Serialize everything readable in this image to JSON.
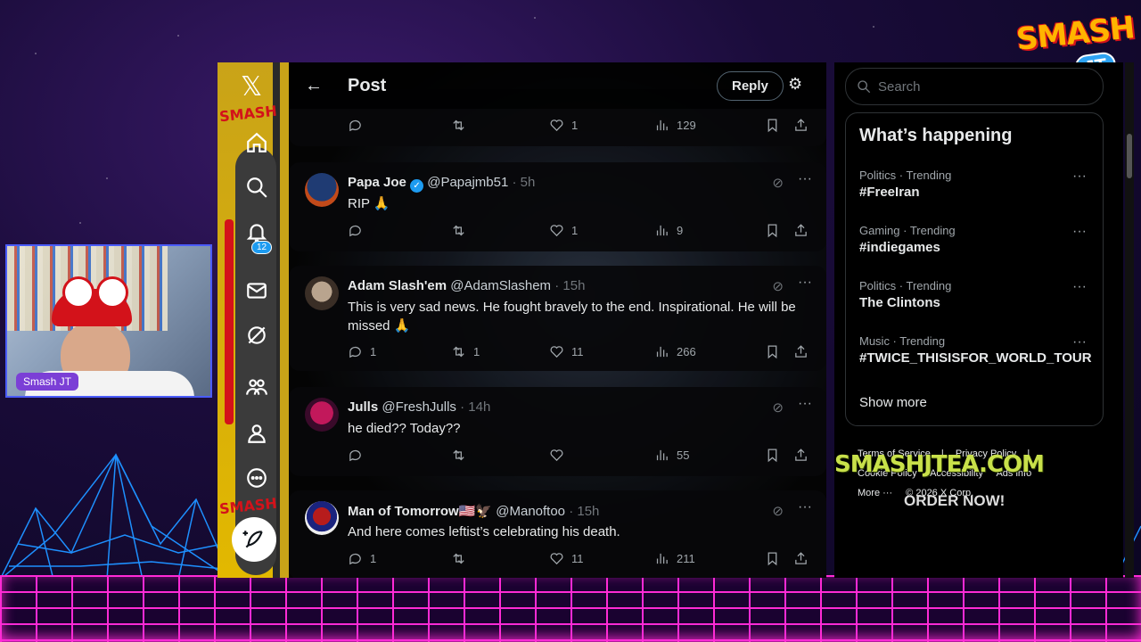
{
  "app": {
    "title": "Post"
  },
  "header": {
    "back_icon": "arrow-left-icon",
    "title": "Post",
    "reply_label": "Reply",
    "filter_icon": "sliders-icon"
  },
  "sidebar": {
    "items": [
      {
        "name": "home",
        "icon": "home-icon"
      },
      {
        "name": "explore",
        "icon": "search-icon"
      },
      {
        "name": "notifications",
        "icon": "bell-icon"
      },
      {
        "name": "messages",
        "icon": "mail-icon"
      },
      {
        "name": "grok",
        "icon": "grok-icon"
      },
      {
        "name": "communities",
        "icon": "people-icon"
      },
      {
        "name": "profile",
        "icon": "person-icon"
      },
      {
        "name": "more",
        "icon": "more-circle-icon"
      }
    ],
    "notification_count": "12",
    "compose_icon": "feather-plus-icon"
  },
  "tweets": [
    {
      "id": "top",
      "name": "",
      "handle": "",
      "time": "",
      "text": "",
      "replies": "",
      "retweets": "",
      "likes": "1",
      "views": "129"
    },
    {
      "id": "papa",
      "name": "Papa Joe",
      "handle": "@Papajmb51",
      "time": "· 5h",
      "text": "RIP 🙏",
      "replies": "",
      "retweets": "",
      "likes": "1",
      "views": "9"
    },
    {
      "id": "adam",
      "name": "Adam Slash'em",
      "handle": "@AdamSlashem",
      "time": "· 15h",
      "text": "This is very sad news. He fought bravely to the end. Inspirational. He will be missed 🙏",
      "replies": "1",
      "retweets": "1",
      "likes": "11",
      "views": "266"
    },
    {
      "id": "julls",
      "name": "Julls",
      "handle": "@FreshJulls",
      "time": "· 14h",
      "text": "he died?? Today??",
      "replies": "",
      "retweets": "",
      "likes": "",
      "views": "55"
    },
    {
      "id": "man",
      "name": "Man of Tomorrow🇺🇸🦅",
      "handle": "@Manoftoo",
      "time": "· 15h",
      "text": "And here comes leftist’s celebrating his death.",
      "replies": "1",
      "retweets": "",
      "likes": "11",
      "views": "211"
    }
  ],
  "search": {
    "placeholder": "Search"
  },
  "trends": {
    "title": "What’s happening",
    "items": [
      {
        "category": "Politics · Trending",
        "tag": "#FreeIran"
      },
      {
        "category": "Gaming · Trending",
        "tag": "#indiegames"
      },
      {
        "category": "Politics · Trending",
        "tag": "The Clintons"
      },
      {
        "category": "Music · Trending",
        "tag": "#TWICE_THISISFOR_WORLD_TOUR"
      }
    ],
    "show_more": "Show more"
  },
  "footer": {
    "terms": "Terms of Service",
    "privacy": "Privacy Policy",
    "cookie": "Cookie Policy",
    "accessibility": "Accessibility",
    "ads": "Ads info",
    "more": "More ···",
    "copyright": "© 2026 X Corp."
  },
  "overlay": {
    "logo_text": "SMASH",
    "logo_sub": "JT",
    "streamer_tag": "Smash JT",
    "promo_url": "SMASHJTEA.COM",
    "promo_cta": "ORDER NOW!"
  },
  "colors": {
    "accent": "#1d9bf0",
    "sidebar_gold": "#e2b800",
    "neon": "#ff2bd6",
    "brand_red": "#d3121a"
  }
}
